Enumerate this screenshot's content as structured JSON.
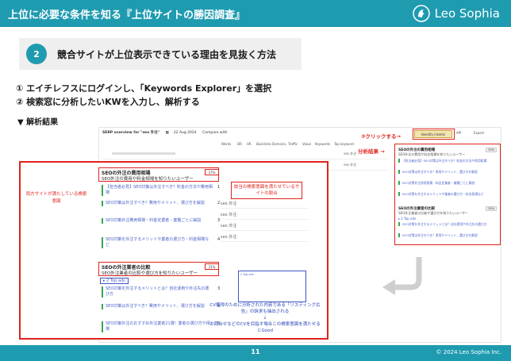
{
  "header": {
    "title": "上位に必要な条件を知る『上位サイトの勝因調査』",
    "brand": "Leo Sophia"
  },
  "step": {
    "number": "2",
    "title": "競合サイトが上位表示できている理由を見抜く方法"
  },
  "instructions": {
    "line1": "① エイチレフスにログインし、「Keywords Explorer」を選択",
    "line2": "② 検索窓に分析したいKWを入力し、解析する"
  },
  "result_heading": "▼ 解析結果",
  "serp": {
    "title": "SERP overview for \"seo 外注\"",
    "date": "22 Aug 2024",
    "compare": "Compare with",
    "columns": [
      "Words",
      "DR",
      "UR",
      "Backlinks",
      "Domains",
      "Traffic",
      "Value",
      "Keywords",
      "Top keyword"
    ],
    "top_ads": "2 Top ads",
    "identify_button": "Identify intents",
    "api": "API",
    "export": "Export",
    "row_values": [
      "seo 外注",
      "seo 外注",
      "seo 外注",
      "seo 外注",
      "seo 外注",
      "seo 外注"
    ]
  },
  "annotations": {
    "click": "③クリックする→",
    "analysis": "分析結果 →",
    "left_note": "両方サイトが満たしている検索意図",
    "mid_note": "該当の検索意図を満たせているサイトの割合",
    "ads_note": "CV獲得のために分析された内容である「リスティング広告」の訴求も抽出される",
    "ads_note2": "お問合せなどのCVを目指す場合この検索意図を満たせるとGood"
  },
  "panel": {
    "section1_title": "SEOの外注の費用相場",
    "section1_sub": "SEO外注の費用や料金相場を知りたいユーザー",
    "section1_badge": "37%",
    "section1_items": [
      {
        "text": "【担当者必見】SEO対策は外注すべき？料金の方法や費用相場",
        "n": "1"
      },
      {
        "text": "SEO対策は外注すべき？費用やメリット、選び方を解説",
        "n": "2"
      },
      {
        "text": "SEO対策外注費用相場・料金定業者・業種ごとに解説",
        "n": "3"
      },
      {
        "text": "SEO対策を外注するメリットや業者の選び方・料金相場など",
        "n": "4"
      }
    ],
    "section2_title": "SEOの外注業者の比較",
    "section2_sub": "SEO外注業者の比較や選び方を知りたいユーザー",
    "section2_badge": "31%",
    "section2_top_ads": "2 Top ads",
    "section2_items": [
      {
        "text": "SEO対策を外注するメリットとは？自社運用や外注先の選び方",
        "n": "3"
      },
      {
        "text": "SEO対策は外注すべき？費用やメリット、選び方を解説",
        "n": "4"
      },
      {
        "text": "SEO対策外注のおすすめ外注業者21選！業者の選び方や相場",
        "n": "5"
      }
    ]
  },
  "footer": {
    "page": "11",
    "copyright": "© 2024 Leo Sophia Inc."
  },
  "colors": {
    "brand": "#1f9bb0",
    "annotation_red": "#e0231c",
    "annotation_blue": "#2b46b8"
  }
}
